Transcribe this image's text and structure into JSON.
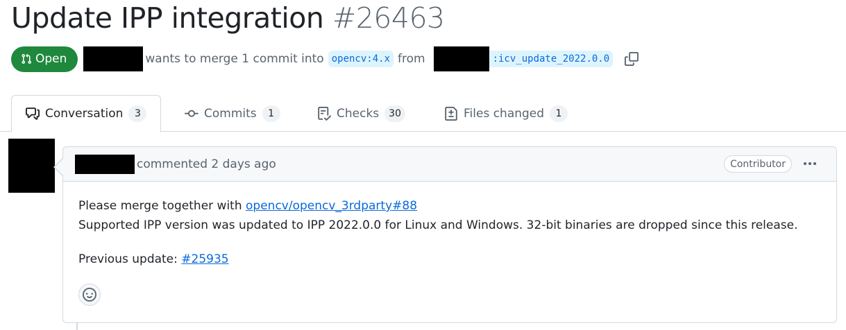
{
  "pr": {
    "title": "Update IPP integration",
    "number": "#26463",
    "state": "Open",
    "merge_text": "wants to merge 1 commit into",
    "base_branch": "opencv:4.x",
    "from_text": "from",
    "head_branch": ":icv_update_2022.0.0"
  },
  "tabs": [
    {
      "label": "Conversation",
      "count": "3"
    },
    {
      "label": "Commits",
      "count": "1"
    },
    {
      "label": "Checks",
      "count": "30"
    },
    {
      "label": "Files changed",
      "count": "1"
    }
  ],
  "comment": {
    "action_text": "commented 2 days ago",
    "role_badge": "Contributor",
    "line1_text": "Please merge together with ",
    "line1_link": "opencv/opencv_3rdparty#88",
    "line2_text": "Supported IPP version was updated to IPP 2022.0.0 for Linux and Windows. 32-bit binaries are dropped since this release.",
    "line3_text": "Previous update: ",
    "line3_link": "#25935"
  },
  "icons": {
    "state": "git-pull-request-icon",
    "copy": "copy-icon",
    "conversation": "comment-discussion-icon",
    "commits": "git-commit-icon",
    "checks": "checklist-icon",
    "files": "file-diff-icon",
    "more": "kebab-horizontal-icon",
    "reaction": "smiley-icon"
  },
  "colors": {
    "open_green": "#1f883d",
    "link_blue": "#0969da",
    "branch_bg": "#ddf4ff",
    "muted_text": "#59636e",
    "border": "#d1d9e0"
  }
}
